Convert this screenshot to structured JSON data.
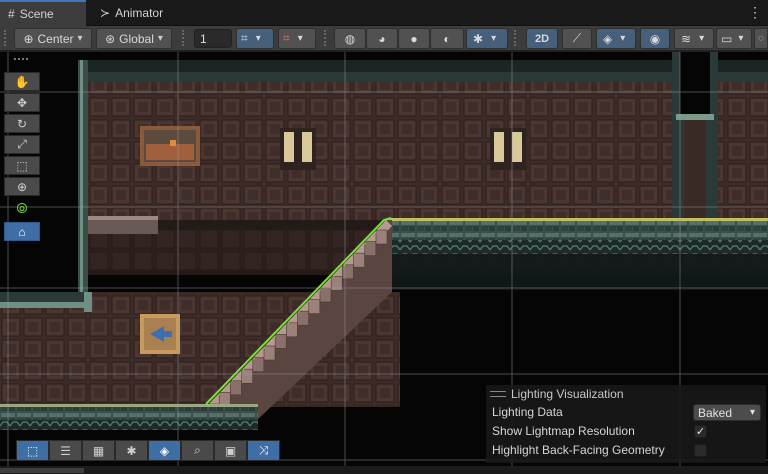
{
  "tabs": [
    {
      "label": "Scene",
      "icon": "grid-icon",
      "active": true
    },
    {
      "label": "Animator",
      "icon": "animator-icon",
      "active": false
    }
  ],
  "toolbar": {
    "pivot_mode": "Center",
    "pivot_rotation": "Global",
    "grid_snap_increment": "1",
    "mode_2d": "2D",
    "icons": [
      "pivot-icon",
      "rotation-icon",
      "grid-snap-icon",
      "snap-settings-icon",
      "wireframe-icon",
      "shaded-wireframe-icon",
      "shaded-icon",
      "unlit-icon",
      "debug-draw-icon",
      "lighting-icon",
      "effects-icon",
      "visibility-icon",
      "layers-icon",
      "camera-icon",
      "gizmos-icon"
    ]
  },
  "scene_tools": [
    {
      "name": "view-tool",
      "icon": "hand-icon",
      "selected": false
    },
    {
      "name": "move-tool",
      "icon": "move-icon",
      "selected": false
    },
    {
      "name": "rotate-tool",
      "icon": "rotate-icon",
      "selected": false
    },
    {
      "name": "scale-tool",
      "icon": "scale-icon",
      "selected": false
    },
    {
      "name": "rect-tool",
      "icon": "rect-icon",
      "selected": false
    },
    {
      "name": "transform-tool",
      "icon": "transform-icon",
      "selected": false
    },
    {
      "name": "edge-collider-tool",
      "icon": "edge-collider-icon",
      "selected": false
    },
    {
      "name": "sprite-shape-tool",
      "icon": "sprite-shape-icon",
      "selected": true
    }
  ],
  "bottom_tools": [
    {
      "icon": "rect-select-icon",
      "selected": true
    },
    {
      "icon": "tile-palette-icon",
      "selected": false
    },
    {
      "icon": "hatch-icon",
      "selected": false
    },
    {
      "icon": "bug-icon",
      "selected": false
    },
    {
      "icon": "collider-icon",
      "selected": true
    },
    {
      "icon": "search-icon",
      "selected": false
    },
    {
      "icon": "camera-icon",
      "selected": false
    },
    {
      "icon": "shuffle-icon",
      "selected": true
    }
  ],
  "lighting_visualization": {
    "title": "Lighting Visualization",
    "lighting_data_label": "Lighting Data",
    "lighting_data_value": "Baked",
    "show_lightmap_label": "Show Lightmap Resolution",
    "show_lightmap_checked": true,
    "highlight_backfacing_label": "Highlight Back-Facing Geometry",
    "highlight_backfacing_checked": false
  },
  "colors": {
    "accent": "#3f6ea4",
    "collider_line": "#7be03c",
    "grid_line": "#9aa0a8"
  }
}
